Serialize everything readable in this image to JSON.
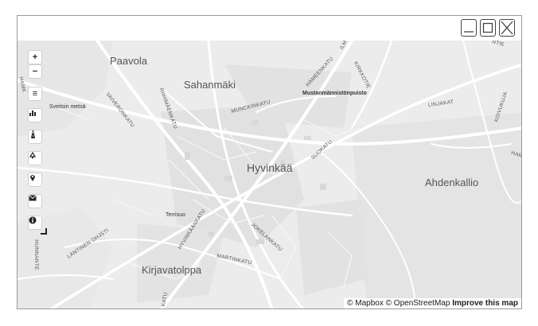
{
  "window": {
    "buttons": [
      "minimize",
      "maximize",
      "close"
    ]
  },
  "map": {
    "controls": [
      {
        "label": "+",
        "icon": "zoom-in-icon"
      },
      {
        "label": "−",
        "icon": "zoom-out-icon"
      },
      {
        "label": "≡",
        "icon": "list-icon"
      },
      {
        "label": "",
        "icon": "bar-chart-icon"
      },
      {
        "label": "",
        "icon": "road-icon"
      },
      {
        "label": "",
        "icon": "recycle-icon"
      },
      {
        "label": "",
        "icon": "map-pin-icon"
      },
      {
        "label": "",
        "icon": "envelope-icon"
      },
      {
        "label": "",
        "icon": "info-icon"
      }
    ],
    "places": {
      "paavola": "Paavola",
      "sahanmaki": "Sahanmäki",
      "hyvinkaa": "Hyvinkää",
      "ahdenkallio": "Ahdenkallio",
      "kirjavatolppa": "Kirjavatolppa",
      "sveitsin": "Sveitsin metsä",
      "terrisuo": "Terrisuo",
      "mustanmannistonpuisto": "Mustanmännistönpuisto"
    },
    "streets": {
      "munckinkatu": "MUNCKINKATU",
      "hameenkatu": "HÄMEENKATU",
      "kirkkotie": "KIRKKOTIE",
      "linjakat": "LINJAKAT",
      "koivukuja": "KOIVUKUJA",
      "suokatu": "SUOKATU",
      "vaiveronkatu": "VAIVERONKATU",
      "riihimaenkatu": "RIIHIMÄENKATU",
      "hyvinkaankatu": "HYVINKÄÄNKATU",
      "jokelankatu": "JOKELANKATU",
      "martinkatu": "MARTINKATU",
      "lantinen_ohjstie": "LÄNTINEN OHJSTI",
      "hunnante": "HUNNANTE",
      "hamk": "HAMK",
      "har": "HAR",
      "ritie": "NTIE",
      "katu": "KATU",
      "ilm": "ILM"
    },
    "attribution": {
      "mapbox": "© Mapbox",
      "osm": "© OpenStreetMap",
      "improve": "Improve this map"
    }
  }
}
